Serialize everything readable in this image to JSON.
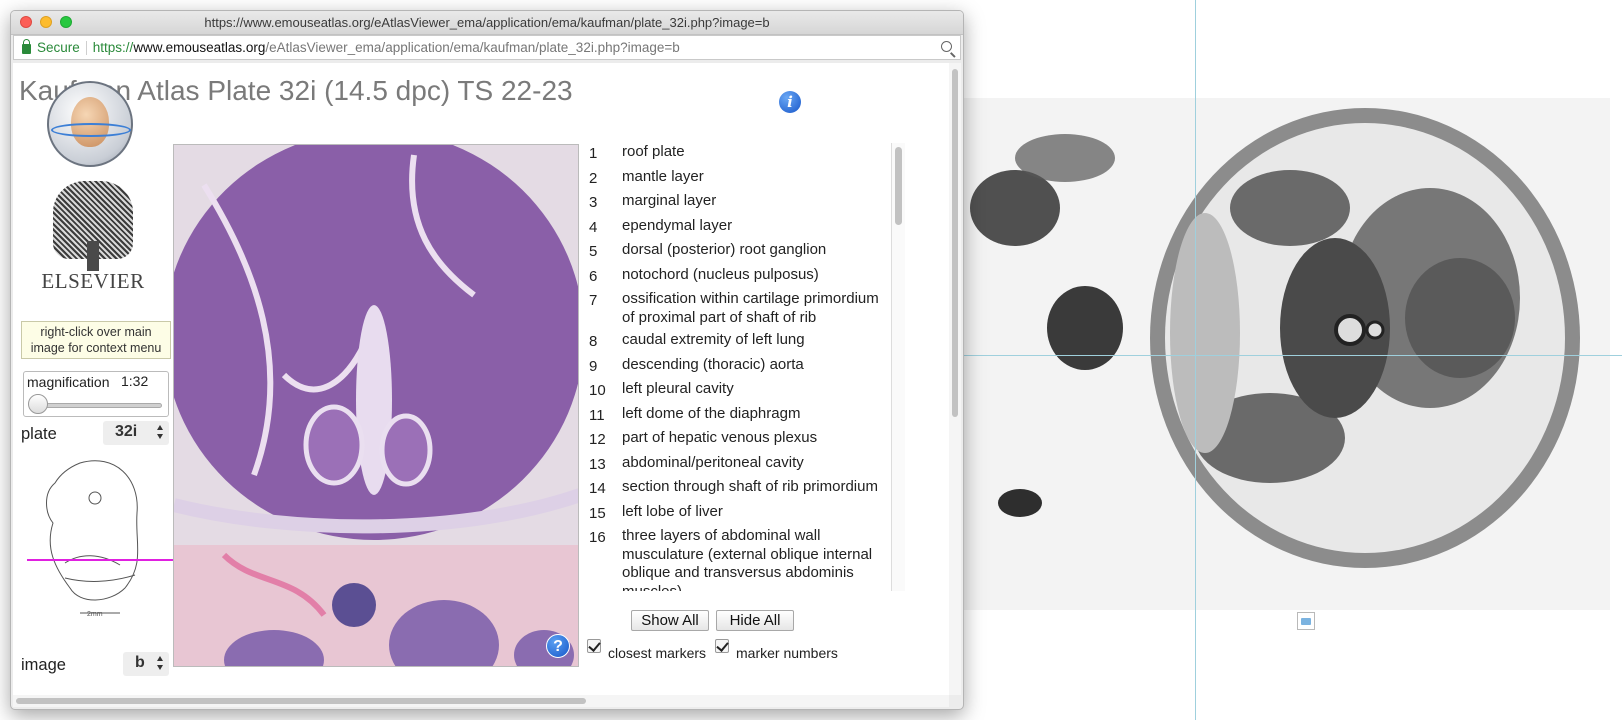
{
  "window": {
    "title": "https://www.emouseatlas.org/eAtlasViewer_ema/application/ema/kaufman/plate_32i.php?image=b"
  },
  "address_bar": {
    "secure_label": "Secure",
    "url_scheme": "https://",
    "url_host": "www.emouseatlas.org",
    "url_path": "/eAtlasViewer_ema/application/ema/kaufman/plate_32i.php?image=b"
  },
  "page": {
    "title": "Kaufman Atlas Plate 32i (14.5 dpc) TS 22-23",
    "info_icon": "i",
    "elsevier_logo_text": "ELSEVIER",
    "hint": "right-click over main image for context menu",
    "magnification_label": "magnification",
    "magnification_value": "1:32",
    "magnification_slider_level": 0,
    "plate_label": "plate",
    "plate_value": "32i",
    "image_label": "image",
    "image_value": "b",
    "scale_label": "2mm",
    "help_icon": "?"
  },
  "legend": {
    "items": [
      {
        "num": "1",
        "text": "roof plate"
      },
      {
        "num": "2",
        "text": "mantle layer"
      },
      {
        "num": "3",
        "text": "marginal layer"
      },
      {
        "num": "4",
        "text": "ependymal layer"
      },
      {
        "num": "5",
        "text": "dorsal (posterior) root ganglion"
      },
      {
        "num": "6",
        "text": "notochord (nucleus pulposus)"
      },
      {
        "num": "7",
        "text": "ossification within cartilage primordium of proximal part of shaft of rib"
      },
      {
        "num": "8",
        "text": "caudal extremity of left lung"
      },
      {
        "num": "9",
        "text": "descending (thoracic) aorta"
      },
      {
        "num": "10",
        "text": "left pleural cavity"
      },
      {
        "num": "11",
        "text": "left dome of the diaphragm"
      },
      {
        "num": "12",
        "text": "part of hepatic venous plexus"
      },
      {
        "num": "13",
        "text": "abdominal/peritoneal cavity"
      },
      {
        "num": "14",
        "text": "section through shaft of rib primordium"
      },
      {
        "num": "15",
        "text": "left lobe of liver"
      },
      {
        "num": "16",
        "text": "three layers of abdominal wall musculature (external oblique internal oblique and transversus abdominis muscles)"
      }
    ],
    "show_all_label": "Show All",
    "hide_all_label": "Hide All",
    "closest_markers_label": "closest markers",
    "closest_markers_checked": true,
    "marker_numbers_label": "marker numbers",
    "marker_numbers_checked": true
  },
  "icons": {
    "close": "close-icon",
    "minimize": "minimize-icon",
    "maximize": "maximize-icon",
    "lock": "lock-icon",
    "zoom": "magnify-icon",
    "info": "info-icon",
    "help": "help-icon",
    "select_arrows": "updown-icon"
  },
  "colors": {
    "secure_green": "#2a8a3a",
    "crosshair": "#9fd0dd",
    "section_line": "#e020e0",
    "info_blue": "#1756c9",
    "tissue_purple": "#8a5fa8"
  }
}
